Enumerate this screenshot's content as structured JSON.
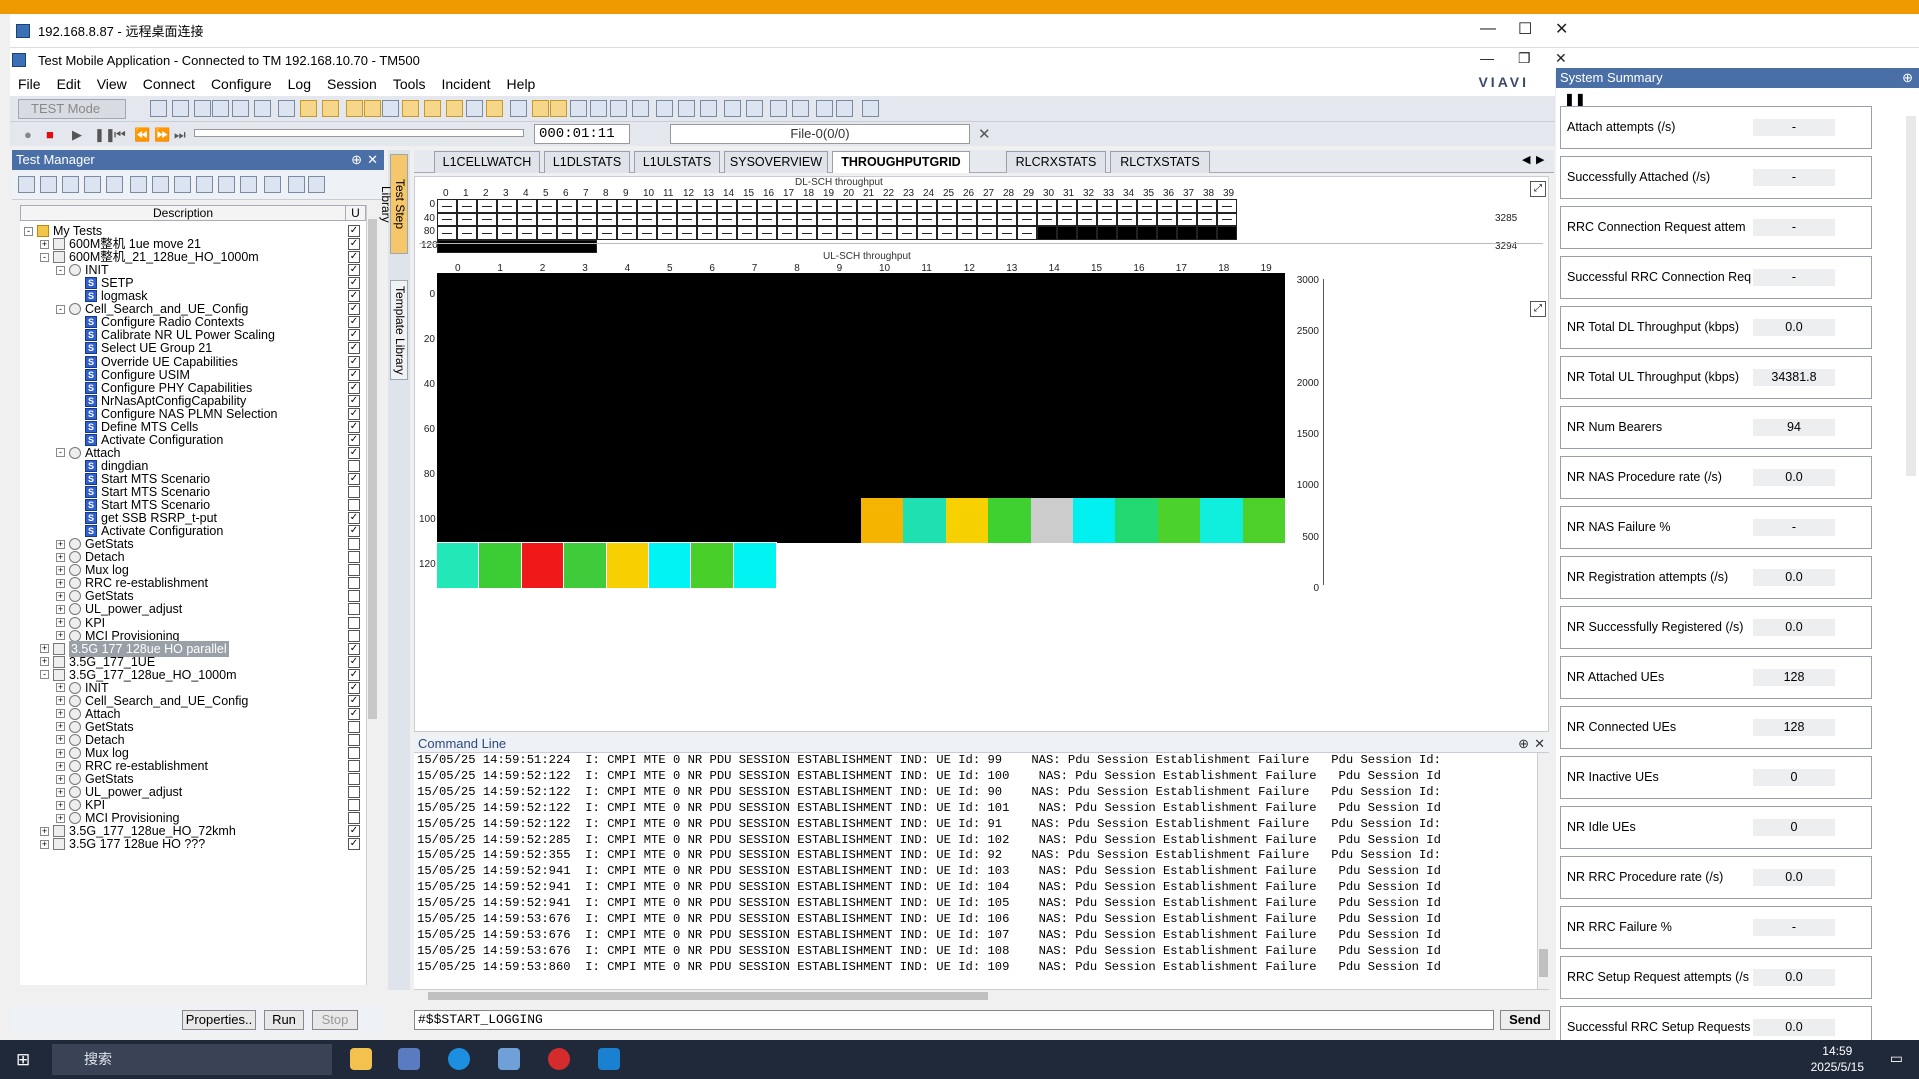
{
  "rdp_title": "192.168.8.87 - 远程桌面连接",
  "app_title": "Test Mobile Application - Connected to TM 192.168.10.70 - TM500",
  "brand": "VIAVI",
  "menu": [
    "File",
    "Edit",
    "View",
    "Connect",
    "Configure",
    "Log",
    "Session",
    "Tools",
    "Incident",
    "Help"
  ],
  "toolbar": {
    "mode": "TEST Mode",
    "time": "000:01:11",
    "file": "File-0(0/0)"
  },
  "test_manager": {
    "title": "Test Manager",
    "col_description": "Description",
    "col_u": "U",
    "tree": [
      {
        "label": "My Tests",
        "level": 0,
        "kind": "folder",
        "exp": "-",
        "check": "x"
      },
      {
        "label": "600M整机 1ue move 21",
        "level": 1,
        "kind": "test",
        "exp": "+",
        "check": "x"
      },
      {
        "label": "600M整机_21_128ue_HO_1000m",
        "level": 1,
        "kind": "test",
        "exp": "-",
        "check": "x"
      },
      {
        "label": "INIT",
        "level": 2,
        "kind": "grp",
        "exp": "-",
        "check": "x"
      },
      {
        "label": "SETP",
        "level": 3,
        "kind": "step",
        "check": "x"
      },
      {
        "label": "logmask",
        "level": 3,
        "kind": "step",
        "check": "x"
      },
      {
        "label": "Cell_Search_and_UE_Config",
        "level": 2,
        "kind": "grp",
        "exp": "-",
        "check": "x"
      },
      {
        "label": "Configure Radio Contexts",
        "level": 3,
        "kind": "step",
        "check": "x"
      },
      {
        "label": "Calibrate NR UL Power Scaling",
        "level": 3,
        "kind": "step",
        "check": "x"
      },
      {
        "label": "Select UE Group 21",
        "level": 3,
        "kind": "step",
        "check": "x"
      },
      {
        "label": "Override UE Capabilities",
        "level": 3,
        "kind": "step",
        "check": "x"
      },
      {
        "label": "Configure USIM",
        "level": 3,
        "kind": "step",
        "check": "x"
      },
      {
        "label": "Configure PHY Capabilities",
        "level": 3,
        "kind": "step",
        "check": "x"
      },
      {
        "label": "NrNasAptConfigCapability",
        "level": 3,
        "kind": "step",
        "check": "x"
      },
      {
        "label": "Configure NAS PLMN Selection",
        "level": 3,
        "kind": "step",
        "check": "x"
      },
      {
        "label": "Define MTS Cells",
        "level": 3,
        "kind": "step",
        "check": "x"
      },
      {
        "label": "Activate Configuration",
        "level": 3,
        "kind": "step",
        "check": "x"
      },
      {
        "label": "Attach",
        "level": 2,
        "kind": "grp",
        "exp": "-",
        "check": "x"
      },
      {
        "label": "dingdian",
        "level": 3,
        "kind": "step",
        "check": ""
      },
      {
        "label": "Start MTS Scenario",
        "level": 3,
        "kind": "step",
        "check": "x"
      },
      {
        "label": "Start MTS Scenario",
        "level": 3,
        "kind": "step",
        "check": ""
      },
      {
        "label": "Start MTS Scenario",
        "level": 3,
        "kind": "step",
        "check": ""
      },
      {
        "label": "get SSB RSRP_t-put",
        "level": 3,
        "kind": "step",
        "check": "x"
      },
      {
        "label": "Activate Configuration",
        "level": 3,
        "kind": "step",
        "check": "x"
      },
      {
        "label": "GetStats",
        "level": 2,
        "kind": "grp",
        "exp": "+",
        "check": ""
      },
      {
        "label": "Detach",
        "level": 2,
        "kind": "grp",
        "exp": "+",
        "check": ""
      },
      {
        "label": "Mux log",
        "level": 2,
        "kind": "grp",
        "exp": "+",
        "check": ""
      },
      {
        "label": "RRC re-establishment",
        "level": 2,
        "kind": "grp",
        "exp": "+",
        "check": ""
      },
      {
        "label": "GetStats",
        "level": 2,
        "kind": "grp",
        "exp": "+",
        "check": ""
      },
      {
        "label": "UL_power_adjust",
        "level": 2,
        "kind": "grp",
        "exp": "+",
        "check": ""
      },
      {
        "label": "KPI",
        "level": 2,
        "kind": "grp",
        "exp": "+",
        "check": ""
      },
      {
        "label": "MCI Provisioning",
        "level": 2,
        "kind": "grp",
        "exp": "+",
        "check": ""
      },
      {
        "label": "3.5G 177 128ue HO parallel",
        "level": 1,
        "kind": "test",
        "exp": "+",
        "check": "x",
        "hl": true
      },
      {
        "label": "3.5G_177_1UE",
        "level": 1,
        "kind": "test",
        "exp": "+",
        "check": "x"
      },
      {
        "label": "3.5G_177_128ue_HO_1000m",
        "level": 1,
        "kind": "test",
        "exp": "-",
        "check": "x"
      },
      {
        "label": "INIT",
        "level": 2,
        "kind": "grp",
        "exp": "+",
        "check": "x"
      },
      {
        "label": "Cell_Search_and_UE_Config",
        "level": 2,
        "kind": "grp",
        "exp": "+",
        "check": "x"
      },
      {
        "label": "Attach",
        "level": 2,
        "kind": "grp",
        "exp": "+",
        "check": "x"
      },
      {
        "label": "GetStats",
        "level": 2,
        "kind": "grp",
        "exp": "+",
        "check": ""
      },
      {
        "label": "Detach",
        "level": 2,
        "kind": "grp",
        "exp": "+",
        "check": ""
      },
      {
        "label": "Mux log",
        "level": 2,
        "kind": "grp",
        "exp": "+",
        "check": ""
      },
      {
        "label": "RRC re-establishment",
        "level": 2,
        "kind": "grp",
        "exp": "+",
        "check": ""
      },
      {
        "label": "GetStats",
        "level": 2,
        "kind": "grp",
        "exp": "+",
        "check": ""
      },
      {
        "label": "UL_power_adjust",
        "level": 2,
        "kind": "grp",
        "exp": "+",
        "check": ""
      },
      {
        "label": "KPI",
        "level": 2,
        "kind": "grp",
        "exp": "+",
        "check": ""
      },
      {
        "label": "MCI Provisioning",
        "level": 2,
        "kind": "grp",
        "exp": "+",
        "check": ""
      },
      {
        "label": "3.5G_177_128ue_HO_72kmh",
        "level": 1,
        "kind": "test",
        "exp": "+",
        "check": "x"
      },
      {
        "label": "3.5G 177 128ue HO ???",
        "level": 1,
        "kind": "test",
        "exp": "+",
        "check": "x"
      }
    ],
    "buttons": {
      "properties": "Properties..",
      "run": "Run",
      "stop": "Stop"
    }
  },
  "side_tabs": [
    "Test Step Library",
    "Template Library"
  ],
  "tabs": [
    "L1CELLWATCH",
    "L1DLSTATS",
    "L1ULSTATS",
    "SYSOVERVIEW",
    "THROUGHPUTGRID",
    "RLCRXSTATS",
    "RLCTXSTATS"
  ],
  "active_tab": "THROUGHPUTGRID",
  "dl_grid": {
    "title": "DL-SCH throughput",
    "columns": [
      "0",
      "1",
      "2",
      "3",
      "4",
      "5",
      "6",
      "7",
      "8",
      "9",
      "10",
      "11",
      "12",
      "13",
      "14",
      "15",
      "16",
      "17",
      "18",
      "19",
      "20",
      "21",
      "22",
      "23",
      "24",
      "25",
      "26",
      "27",
      "28",
      "29",
      "30",
      "31",
      "32",
      "33",
      "34",
      "35",
      "36",
      "37",
      "38",
      "39"
    ],
    "rows": [
      "0",
      "40",
      "80",
      "120"
    ],
    "right_labels": [
      "3285",
      "3294"
    ],
    "black_row80_from_col": 30,
    "black_row120_cols": 8
  },
  "ul_grid": {
    "title": "UL-SCH throughput",
    "columns": [
      "0",
      "1",
      "2",
      "3",
      "4",
      "5",
      "6",
      "7",
      "8",
      "9",
      "10",
      "11",
      "12",
      "13",
      "14",
      "15",
      "16",
      "17",
      "18",
      "19"
    ],
    "rows": [
      "0",
      "20",
      "40",
      "60",
      "80",
      "100",
      "120"
    ],
    "scale": [
      "3000",
      "2500",
      "2000",
      "1500",
      "1000",
      "500",
      "0"
    ],
    "row100": [
      "",
      "",
      "",
      "",
      "",
      "",
      "",
      "",
      "",
      "",
      "#f5b400",
      "#1fe0b0",
      "#f7d000",
      "#3ed130",
      "#cccccc",
      "#00f0f0",
      "#22d870",
      "#4cd22c",
      "#10eedd",
      "#4dd02a"
    ],
    "row120": [
      "#22e8b8",
      "#3ccc34",
      "#f01818",
      "#3ecc3a",
      "#f8cf00",
      "#00f4f4",
      "#48cf2a",
      "#00f4f2"
    ]
  },
  "command_line": {
    "title": "Command Line",
    "lines": [
      "15/05/25 14:59:51:224  I: CMPI MTE 0 NR PDU SESSION ESTABLISHMENT IND: UE Id: 99    NAS: Pdu Session Establishment Failure   Pdu Session Id:",
      "15/05/25 14:59:52:122  I: CMPI MTE 0 NR PDU SESSION ESTABLISHMENT IND: UE Id: 100    NAS: Pdu Session Establishment Failure   Pdu Session Id",
      "15/05/25 14:59:52:122  I: CMPI MTE 0 NR PDU SESSION ESTABLISHMENT IND: UE Id: 90    NAS: Pdu Session Establishment Failure   Pdu Session Id:",
      "15/05/25 14:59:52:122  I: CMPI MTE 0 NR PDU SESSION ESTABLISHMENT IND: UE Id: 101    NAS: Pdu Session Establishment Failure   Pdu Session Id",
      "15/05/25 14:59:52:122  I: CMPI MTE 0 NR PDU SESSION ESTABLISHMENT IND: UE Id: 91    NAS: Pdu Session Establishment Failure   Pdu Session Id:",
      "15/05/25 14:59:52:285  I: CMPI MTE 0 NR PDU SESSION ESTABLISHMENT IND: UE Id: 102    NAS: Pdu Session Establishment Failure   Pdu Session Id",
      "15/05/25 14:59:52:355  I: CMPI MTE 0 NR PDU SESSION ESTABLISHMENT IND: UE Id: 92    NAS: Pdu Session Establishment Failure   Pdu Session Id:",
      "15/05/25 14:59:52:941  I: CMPI MTE 0 NR PDU SESSION ESTABLISHMENT IND: UE Id: 103    NAS: Pdu Session Establishment Failure   Pdu Session Id",
      "15/05/25 14:59:52:941  I: CMPI MTE 0 NR PDU SESSION ESTABLISHMENT IND: UE Id: 104    NAS: Pdu Session Establishment Failure   Pdu Session Id",
      "15/05/25 14:59:52:941  I: CMPI MTE 0 NR PDU SESSION ESTABLISHMENT IND: UE Id: 105    NAS: Pdu Session Establishment Failure   Pdu Session Id",
      "15/05/25 14:59:53:676  I: CMPI MTE 0 NR PDU SESSION ESTABLISHMENT IND: UE Id: 106    NAS: Pdu Session Establishment Failure   Pdu Session Id",
      "15/05/25 14:59:53:676  I: CMPI MTE 0 NR PDU SESSION ESTABLISHMENT IND: UE Id: 107    NAS: Pdu Session Establishment Failure   Pdu Session Id",
      "15/05/25 14:59:53:676  I: CMPI MTE 0 NR PDU SESSION ESTABLISHMENT IND: UE Id: 108    NAS: Pdu Session Establishment Failure   Pdu Session Id",
      "15/05/25 14:59:53:860  I: CMPI MTE 0 NR PDU SESSION ESTABLISHMENT IND: UE Id: 109    NAS: Pdu Session Establishment Failure   Pdu Session Id"
    ],
    "input": "#$$START_LOGGING",
    "send": "Send"
  },
  "system_summary": {
    "title": "System Summary",
    "cards": [
      {
        "name": "Attach attempts (/s)",
        "value": "-"
      },
      {
        "name": "Successfully Attached (/s)",
        "value": "-"
      },
      {
        "name": "RRC Connection Request attem",
        "value": "-"
      },
      {
        "name": "Successful RRC Connection Req",
        "value": "-"
      },
      {
        "name": "NR Total DL Throughput (kbps)",
        "value": "0.0"
      },
      {
        "name": "NR Total UL Throughput (kbps)",
        "value": "34381.8"
      },
      {
        "name": "NR Num Bearers",
        "value": "94"
      },
      {
        "name": "NR NAS Procedure rate (/s)",
        "value": "0.0"
      },
      {
        "name": "NR NAS Failure %",
        "value": "-"
      },
      {
        "name": "NR Registration attempts (/s)",
        "value": "0.0"
      },
      {
        "name": "NR Successfully Registered (/s)",
        "value": "0.0"
      },
      {
        "name": "NR Attached UEs",
        "value": "128"
      },
      {
        "name": "NR Connected UEs",
        "value": "128"
      },
      {
        "name": "NR Inactive UEs",
        "value": "0"
      },
      {
        "name": "NR Idle UEs",
        "value": "0"
      },
      {
        "name": "NR RRC Procedure rate (/s)",
        "value": "0.0"
      },
      {
        "name": "NR RRC Failure %",
        "value": "-"
      },
      {
        "name": "RRC Setup Request attempts (/s",
        "value": "0.0"
      },
      {
        "name": "Successful RRC Setup Requests",
        "value": "0.0"
      }
    ]
  },
  "taskbar": {
    "search": "搜索",
    "time": "14:59",
    "date": "2025/5/15"
  }
}
